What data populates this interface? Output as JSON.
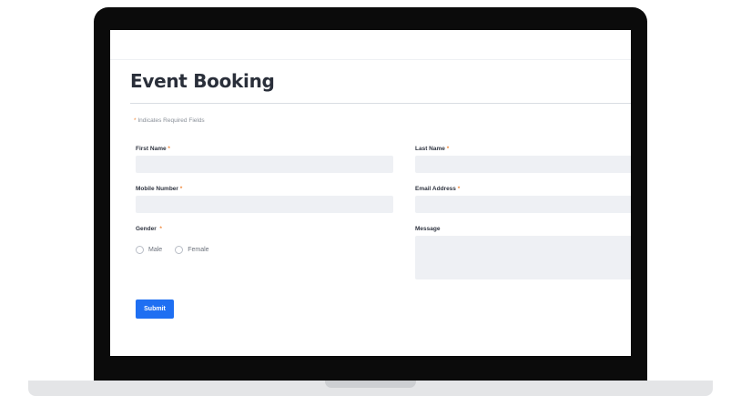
{
  "form": {
    "title": "Event Booking",
    "required_note_star": "*",
    "required_note": " Indicates Required Fields",
    "required_mark": "*",
    "first_name_label": "First Name",
    "last_name_label": "Last Name",
    "mobile_label": "Mobile Number",
    "email_label": "Email Address",
    "gender_label": "Gender",
    "message_label": "Message",
    "gender_options": [
      "Male",
      "Female"
    ],
    "submit_label": "Submit"
  },
  "colors": {
    "accent": "#1f6ff2",
    "required": "#f0883a",
    "field_bg": "#eef0f4",
    "laptop_frame": "#0b0b0b"
  }
}
